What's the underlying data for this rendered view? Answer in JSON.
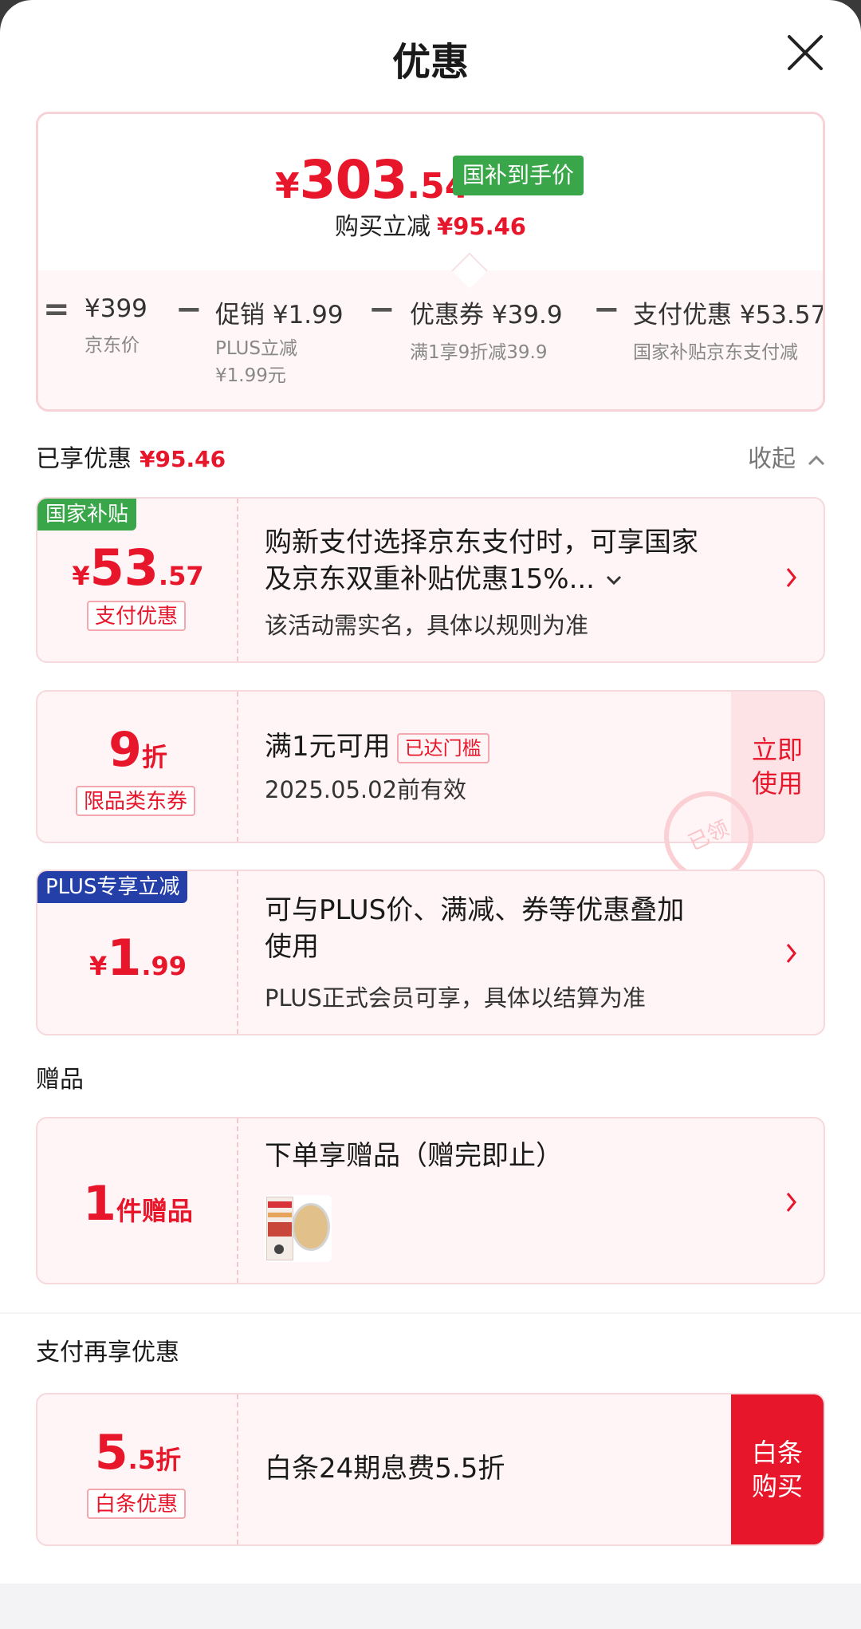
{
  "header": {
    "title": "优惠"
  },
  "summary": {
    "currency": "¥",
    "final_int": "303",
    "final_dec": ".54",
    "badge": "国补到手价",
    "reduce_label": "购买立减",
    "reduce_amount": "¥95.46",
    "breakdown": [
      {
        "op": "=",
        "main": "¥399",
        "sub": "京东价"
      },
      {
        "op": "−",
        "main": "促销 ¥1.99",
        "sub": "PLUS立减",
        "sub2": "¥1.99元"
      },
      {
        "op": "−",
        "main": "优惠券 ¥39.9",
        "sub": "满1享9折减39.9"
      },
      {
        "op": "−",
        "main": "支付优惠 ¥53.57",
        "sub": "国家补贴京东支付减"
      }
    ]
  },
  "enjoyed": {
    "label": "已享优惠",
    "amount": "¥95.46",
    "collapse": "收起"
  },
  "cards": {
    "subsidy": {
      "corner": "国家补贴",
      "cur": "¥",
      "int": "53",
      "dec": ".57",
      "tag": "支付优惠",
      "title_line1": "购新支付选择京东支付时，可享国家",
      "title_line2": "及京东双重补贴优惠15%...",
      "sub": "该活动需实名，具体以规则为准"
    },
    "coupon": {
      "int": "9",
      "unit": "折",
      "tag": "限品类东券",
      "title": "满1元可用",
      "threshold": "已达门槛",
      "sub": "2025.05.02前有效",
      "action_line1": "立即",
      "action_line2": "使用",
      "stamp": "已领"
    },
    "plus": {
      "corner": "PLUS专享立减",
      "cur": "¥",
      "int": "1",
      "dec": ".99",
      "title_line1": "可与PLUS价、满减、券等优惠叠加",
      "title_line2": "使用",
      "sub": "PLUS正式会员可享，具体以结算为准"
    }
  },
  "gift": {
    "section": "赠品",
    "count": "1",
    "unit": "件赠品",
    "title": "下单享赠品（赠完即止）"
  },
  "pay": {
    "section": "支付再享优惠",
    "int": "5",
    "dec": ".5",
    "unit": "折",
    "tag": "白条优惠",
    "title": "白条24期息费5.5折",
    "action_line1": "白条",
    "action_line2": "购买"
  },
  "colors": {
    "accent": "#e8162b",
    "green": "#3aa64a",
    "plus_blue": "#2440a8"
  }
}
